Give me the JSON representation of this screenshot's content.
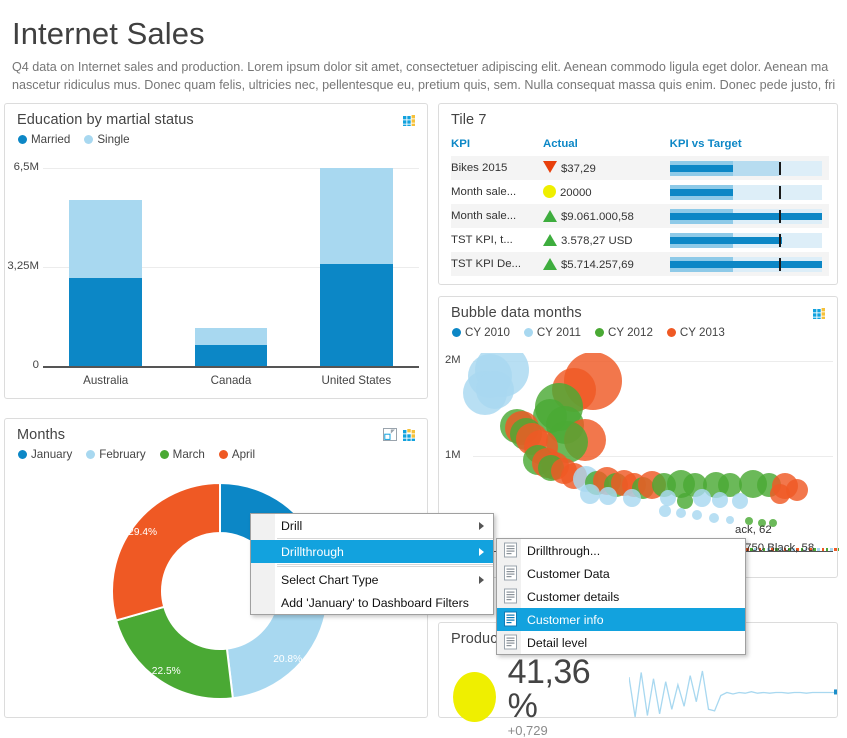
{
  "header": {
    "title": "Internet Sales",
    "desc_line1": "Q4 data on Internet sales and production. Lorem ipsum dolor sit amet, consectetuer adipiscing elit. Aenean commodo ligula eget dolor. Aenean ma",
    "desc_line2": "nascetur ridiculus mus. Donec quam felis, ultricies nec, pellentesque eu, pretium quis, sem. Nulla consequat massa quis enim. Donec pede justo, fri"
  },
  "colors": {
    "dark_blue": "#0c87c6",
    "light_blue": "#a8d8f0",
    "green": "#4aa934",
    "orange": "#ef5924",
    "yellow": "#efef00",
    "red": "#e8400c",
    "accent_header": "#0c87c6",
    "menu_highlight": "#12a2de"
  },
  "tiles": {
    "education": {
      "title": "Education by martial status",
      "icons": [
        "grid-icon"
      ]
    },
    "kpi": {
      "title": "Tile 7",
      "columns": [
        "KPI",
        "Actual",
        "KPI vs Target"
      ],
      "rows": [
        {
          "kpi": "Bikes 2015",
          "actual": "$37,29",
          "status": "down",
          "value_pct": 42,
          "band1": 42,
          "band2": 72,
          "target_pct": 72
        },
        {
          "kpi": "Month sale...",
          "actual": "20000",
          "status": "neutral",
          "value_pct": 42,
          "band1": 42,
          "band2": 42,
          "target_pct": 72
        },
        {
          "kpi": "Month sale...",
          "actual": "$9.061.000,58",
          "status": "up",
          "value_pct": 100,
          "band1": 42,
          "band2": 42,
          "target_pct": 72
        },
        {
          "kpi": "TST KPI, t...",
          "actual": "3.578,27 USD",
          "status": "up",
          "value_pct": 74,
          "band1": 42,
          "band2": 42,
          "target_pct": 72
        },
        {
          "kpi": "TST KPI De...",
          "actual": "$5.714.257,69",
          "status": "up",
          "value_pct": 100,
          "band1": 42,
          "band2": 42,
          "target_pct": 72
        }
      ]
    },
    "bubble": {
      "title": "Bubble data months",
      "icons": [
        "grid-icon"
      ],
      "cat_label_1": "ack, 62",
      "cat_label_2": "d-750 Black, 58"
    },
    "months": {
      "title": "Months",
      "icons": [
        "expand-icon",
        "grid-icon"
      ]
    },
    "product": {
      "title": "Produc",
      "value": "41,36 %",
      "delta": "+0,729",
      "status_color": "#efef00"
    }
  },
  "context_menu": {
    "items": [
      {
        "label": "Drill",
        "submenu": true,
        "selected": false
      },
      {
        "label": "Drillthrough",
        "submenu": true,
        "selected": true
      },
      {
        "label": "Select Chart Type",
        "submenu": true,
        "selected": false
      },
      {
        "label": "Add 'January' to Dashboard Filters",
        "submenu": false,
        "selected": false
      }
    ]
  },
  "context_submenu": {
    "items": [
      {
        "label": "Drillthrough...",
        "selected": false
      },
      {
        "label": "Customer Data",
        "selected": false
      },
      {
        "label": "Customer details",
        "selected": false
      },
      {
        "label": "Customer info",
        "selected": true
      },
      {
        "label": "Detail level",
        "selected": false
      }
    ]
  },
  "chart_data": [
    {
      "type": "bar",
      "id": "education-by-marital-status",
      "title": "Education by martial status",
      "stacked": true,
      "categories": [
        "Australia",
        "Canada",
        "United States"
      ],
      "series": [
        {
          "name": "Married",
          "color": "#0c87c6",
          "values": [
            2900000,
            700000,
            3350000
          ]
        },
        {
          "name": "Single",
          "color": "#a8d8f0",
          "values": [
            2550000,
            550000,
            3150000
          ]
        }
      ],
      "ylabel": "",
      "xlabel": "",
      "ylim": [
        0,
        6500000
      ],
      "ytick_labels": [
        "0",
        "3,25M",
        "6,5M"
      ],
      "ytick_values": [
        0,
        3250000,
        6500000
      ],
      "grid": true,
      "legend_position": "top-left"
    },
    {
      "type": "pie",
      "id": "months-donut",
      "title": "Months",
      "donut": true,
      "labels": [
        "January",
        "February",
        "March",
        "April"
      ],
      "values": [
        27.3,
        20.8,
        22.5,
        29.4
      ],
      "value_labels": [
        "",
        "20.8%",
        "22.5%",
        "29.4%"
      ],
      "colors": [
        "#0c87c6",
        "#a8d8f0",
        "#4aa934",
        "#ef5924"
      ],
      "legend_position": "top-left"
    },
    {
      "type": "scatter",
      "id": "bubble-data-months",
      "title": "Bubble data months",
      "ylim": [
        0,
        2000000
      ],
      "ytick_labels": [
        "1M",
        "2M"
      ],
      "ytick_values": [
        1000000,
        2000000
      ],
      "grid": true,
      "legend_position": "top-left",
      "series": [
        {
          "name": "CY 2010",
          "color": "#0c87c6"
        },
        {
          "name": "CY 2011",
          "color": "#a8d8f0"
        },
        {
          "name": "CY 2012",
          "color": "#4aa934"
        },
        {
          "name": "CY 2013",
          "color": "#ef5924"
        }
      ],
      "points": [
        {
          "s": 1,
          "x": 22,
          "y": 1910000,
          "r": 27
        },
        {
          "s": 1,
          "x": 13,
          "y": 1840000,
          "r": 22
        },
        {
          "s": 1,
          "x": 9,
          "y": 1660000,
          "r": 22
        },
        {
          "s": 1,
          "x": 17,
          "y": 1700000,
          "r": 19
        },
        {
          "s": 3,
          "x": 92,
          "y": 1790000,
          "r": 29
        },
        {
          "s": 3,
          "x": 78,
          "y": 1700000,
          "r": 22
        },
        {
          "s": 2,
          "x": 66,
          "y": 1520000,
          "r": 24
        },
        {
          "s": 2,
          "x": 59,
          "y": 1420000,
          "r": 17
        },
        {
          "s": 2,
          "x": 71,
          "y": 1330000,
          "r": 19
        },
        {
          "s": 3,
          "x": 86,
          "y": 1170000,
          "r": 21
        },
        {
          "s": 2,
          "x": 72,
          "y": 1150000,
          "r": 21
        },
        {
          "s": 2,
          "x": 34,
          "y": 1320000,
          "r": 17
        },
        {
          "s": 3,
          "x": 38,
          "y": 1300000,
          "r": 17
        },
        {
          "s": 2,
          "x": 41,
          "y": 1230000,
          "r": 16
        },
        {
          "s": 3,
          "x": 45,
          "y": 1180000,
          "r": 16
        },
        {
          "s": 3,
          "x": 52,
          "y": 1100000,
          "r": 17
        },
        {
          "s": 2,
          "x": 50,
          "y": 960000,
          "r": 15
        },
        {
          "s": 3,
          "x": 57,
          "y": 930000,
          "r": 15
        },
        {
          "s": 3,
          "x": 63,
          "y": 900000,
          "r": 14
        },
        {
          "s": 2,
          "x": 60,
          "y": 870000,
          "r": 13
        },
        {
          "s": 3,
          "x": 70,
          "y": 840000,
          "r": 13
        },
        {
          "s": 3,
          "x": 78,
          "y": 790000,
          "r": 13
        },
        {
          "s": 1,
          "x": 87,
          "y": 760000,
          "r": 13
        },
        {
          "s": 2,
          "x": 95,
          "y": 720000,
          "r": 12
        },
        {
          "s": 3,
          "x": 103,
          "y": 740000,
          "r": 14
        },
        {
          "s": 2,
          "x": 110,
          "y": 690000,
          "r": 12
        },
        {
          "s": 3,
          "x": 116,
          "y": 720000,
          "r": 13
        },
        {
          "s": 3,
          "x": 124,
          "y": 690000,
          "r": 12
        },
        {
          "s": 2,
          "x": 131,
          "y": 660000,
          "r": 11
        },
        {
          "s": 3,
          "x": 138,
          "y": 700000,
          "r": 14
        },
        {
          "s": 2,
          "x": 147,
          "y": 690000,
          "r": 12
        },
        {
          "s": 2,
          "x": 160,
          "y": 710000,
          "r": 14
        },
        {
          "s": 2,
          "x": 171,
          "y": 690000,
          "r": 12
        },
        {
          "s": 2,
          "x": 187,
          "y": 700000,
          "r": 13
        },
        {
          "s": 2,
          "x": 198,
          "y": 690000,
          "r": 12
        },
        {
          "s": 2,
          "x": 215,
          "y": 710000,
          "r": 14
        },
        {
          "s": 2,
          "x": 228,
          "y": 700000,
          "r": 12
        },
        {
          "s": 3,
          "x": 240,
          "y": 680000,
          "r": 13
        },
        {
          "s": 3,
          "x": 249,
          "y": 640000,
          "r": 11
        },
        {
          "s": 3,
          "x": 236,
          "y": 600000,
          "r": 10
        },
        {
          "s": 1,
          "x": 90,
          "y": 600000,
          "r": 10
        },
        {
          "s": 1,
          "x": 104,
          "y": 580000,
          "r": 9
        },
        {
          "s": 1,
          "x": 122,
          "y": 560000,
          "r": 9
        },
        {
          "s": 1,
          "x": 150,
          "y": 555000,
          "r": 8
        },
        {
          "s": 1,
          "x": 176,
          "y": 560000,
          "r": 9
        },
        {
          "s": 1,
          "x": 190,
          "y": 540000,
          "r": 8
        },
        {
          "s": 1,
          "x": 205,
          "y": 530000,
          "r": 8
        },
        {
          "s": 2,
          "x": 163,
          "y": 530000,
          "r": 8
        },
        {
          "s": 1,
          "x": 148,
          "y": 420000,
          "r": 6
        },
        {
          "s": 1,
          "x": 160,
          "y": 400000,
          "r": 5
        },
        {
          "s": 1,
          "x": 172,
          "y": 380000,
          "r": 5
        },
        {
          "s": 1,
          "x": 185,
          "y": 350000,
          "r": 5
        },
        {
          "s": 1,
          "x": 198,
          "y": 330000,
          "r": 4
        },
        {
          "s": 2,
          "x": 212,
          "y": 320000,
          "r": 4
        },
        {
          "s": 2,
          "x": 222,
          "y": 300000,
          "r": 4
        },
        {
          "s": 2,
          "x": 231,
          "y": 290000,
          "r": 4
        }
      ]
    },
    {
      "type": "line",
      "id": "product-sparkline",
      "title": "",
      "color": "#a8d8f0",
      "values": [
        72,
        20,
        78,
        22,
        70,
        24,
        66,
        30,
        62,
        34,
        74,
        40,
        80,
        30,
        28,
        48,
        52,
        50,
        52,
        51,
        53,
        51,
        52,
        51,
        52,
        52,
        51,
        52,
        52,
        51,
        52,
        52,
        52,
        52,
        52
      ]
    }
  ]
}
